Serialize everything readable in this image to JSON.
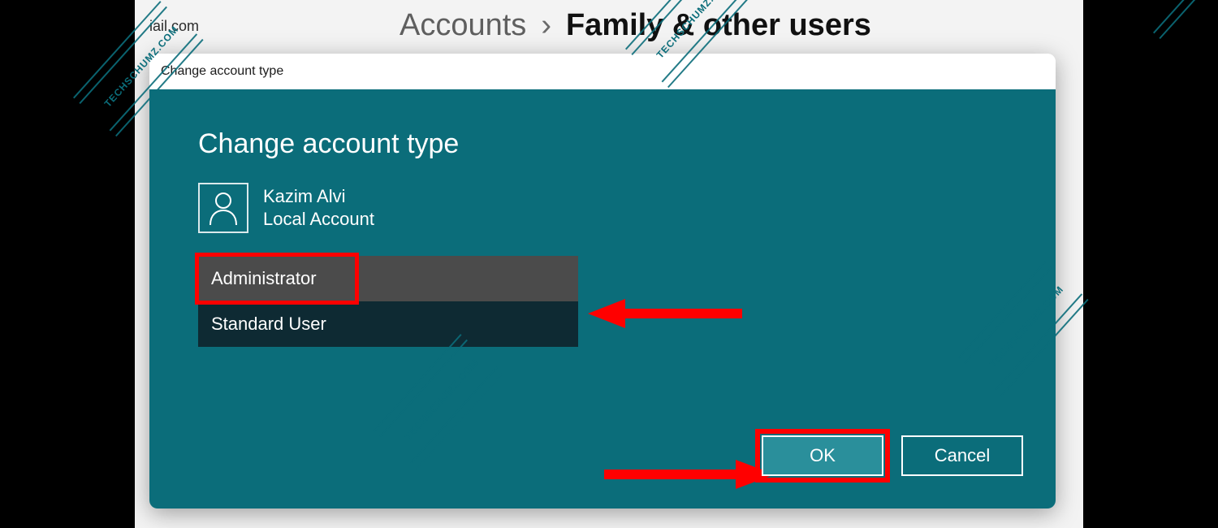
{
  "header": {
    "email_fragment": "iail.com"
  },
  "breadcrumb": {
    "parent": "Accounts",
    "separator": "›",
    "current": "Family & other users"
  },
  "dialog": {
    "window_title": "Change account type",
    "heading": "Change account type",
    "user": {
      "name": "Kazim Alvi",
      "account_type": "Local Account"
    },
    "account_type_options": {
      "selected": "Administrator",
      "other": "Standard User"
    },
    "buttons": {
      "ok": "OK",
      "cancel": "Cancel"
    }
  },
  "colors": {
    "teal_body": "#0b6d7a",
    "select_selected_bg": "#4b4b4b",
    "select_other_bg": "#0e2a33",
    "annotation_red": "#ff0000"
  },
  "watermark": {
    "text": "TECHSCHUMZ.COM"
  }
}
